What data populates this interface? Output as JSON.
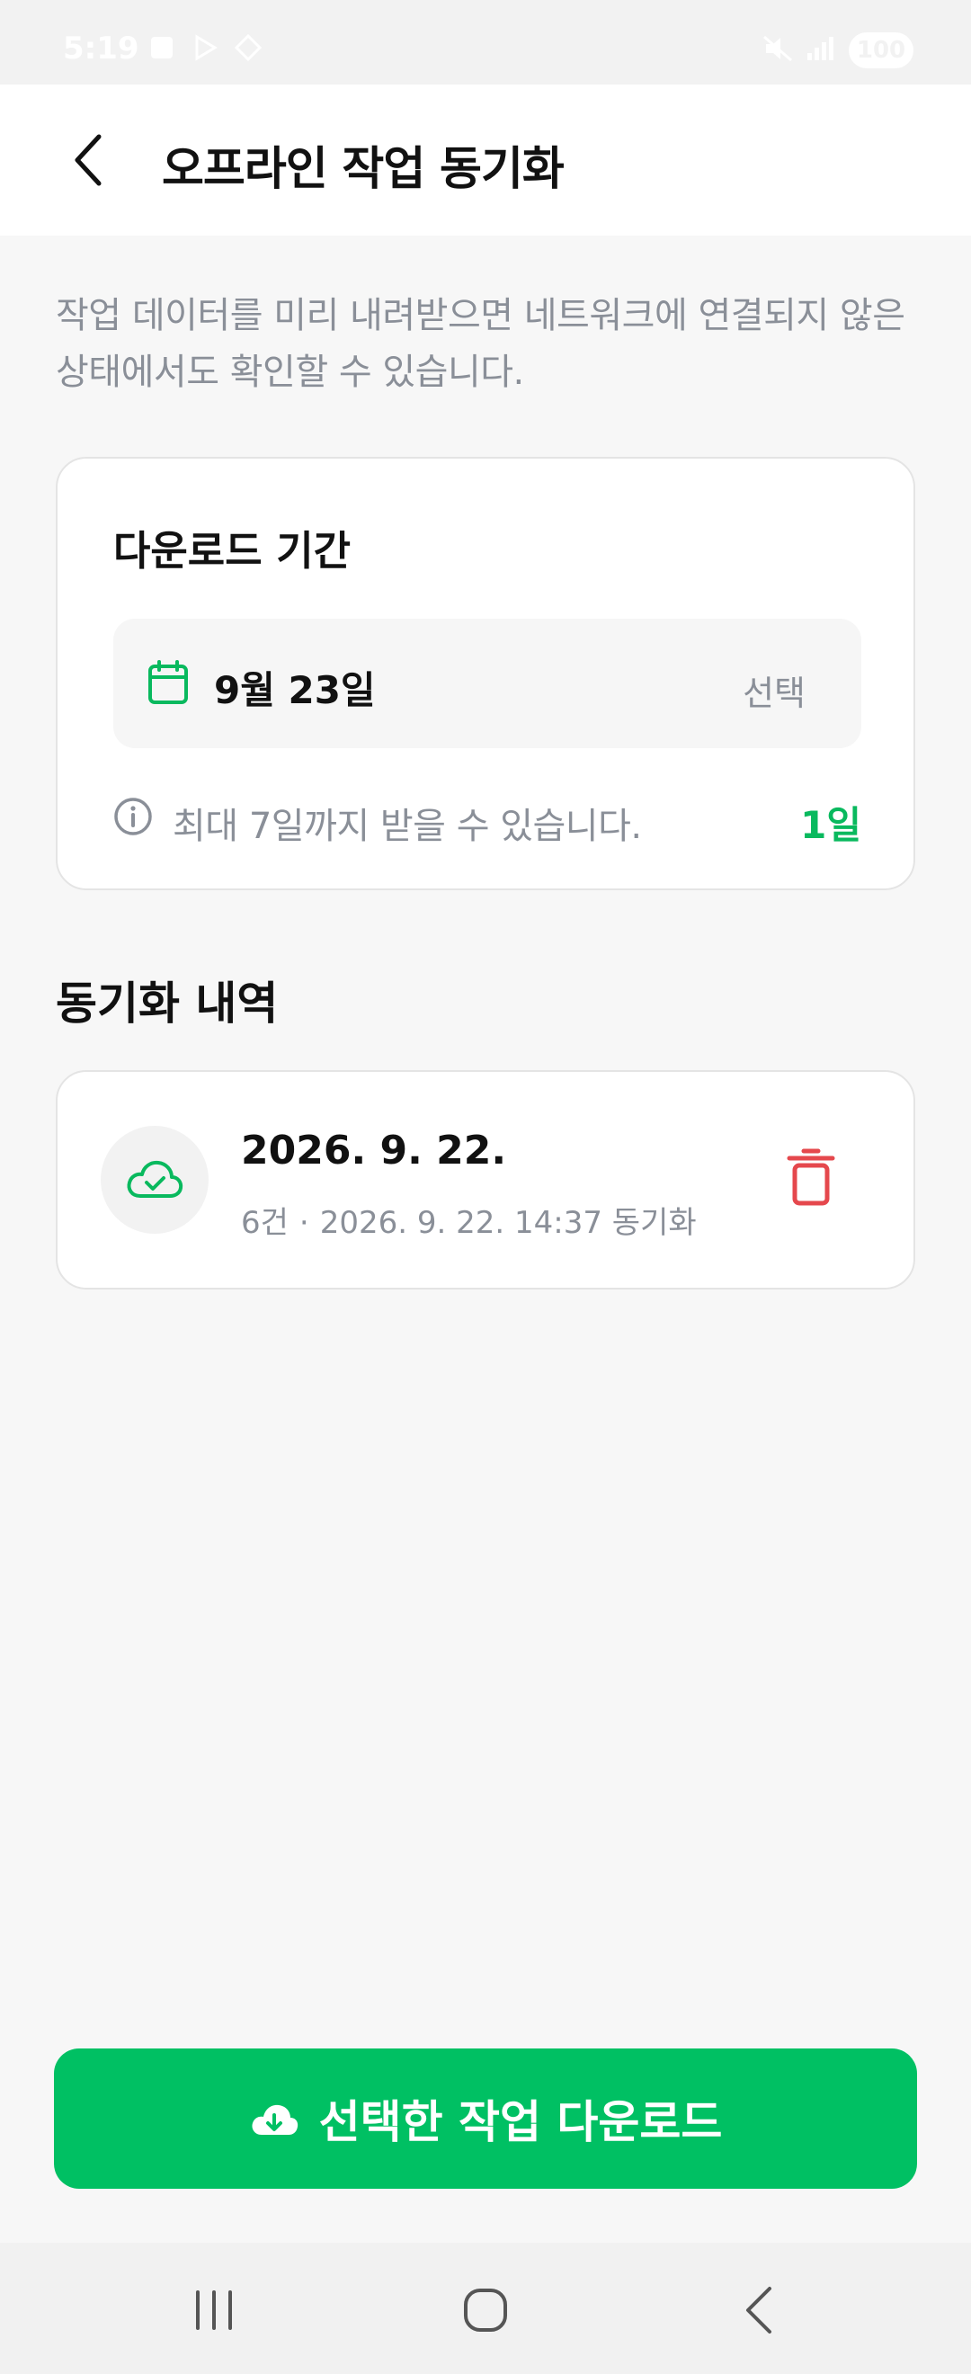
{
  "status_bar": {
    "time": "5:19",
    "battery": "100"
  },
  "header": {
    "title": "오프라인 작업 동기화",
    "back_icon": "chevron-left-icon"
  },
  "description": "작업 데이터를 미리 내려받으면 네트워크에 연결되지 않은 상태에서도 확인할 수 있습니다.",
  "download_period": {
    "title": "다운로드 기간",
    "date": "9월 23일",
    "select_label": "선택",
    "info": "최대 7일까지 받을 수 있습니다.",
    "days": "1일",
    "accent_color": "#09b95e"
  },
  "history": {
    "title": "동기화 내역",
    "items": [
      {
        "date": "2026. 9. 22.",
        "count": "6건",
        "separator": "·",
        "synced_at": "2026. 9. 22. 14:37 동기화",
        "icon": "cloud-check-icon",
        "delete_icon": "trash-icon",
        "delete_color": "#e5484d"
      }
    ]
  },
  "download_button": {
    "label": "선택한 작업 다운로드",
    "icon": "cloud-download-icon",
    "color": "#00c063"
  },
  "nav_bar": {
    "recent_icon": "recent-apps-icon",
    "home_icon": "home-icon",
    "back_icon": "back-icon"
  }
}
